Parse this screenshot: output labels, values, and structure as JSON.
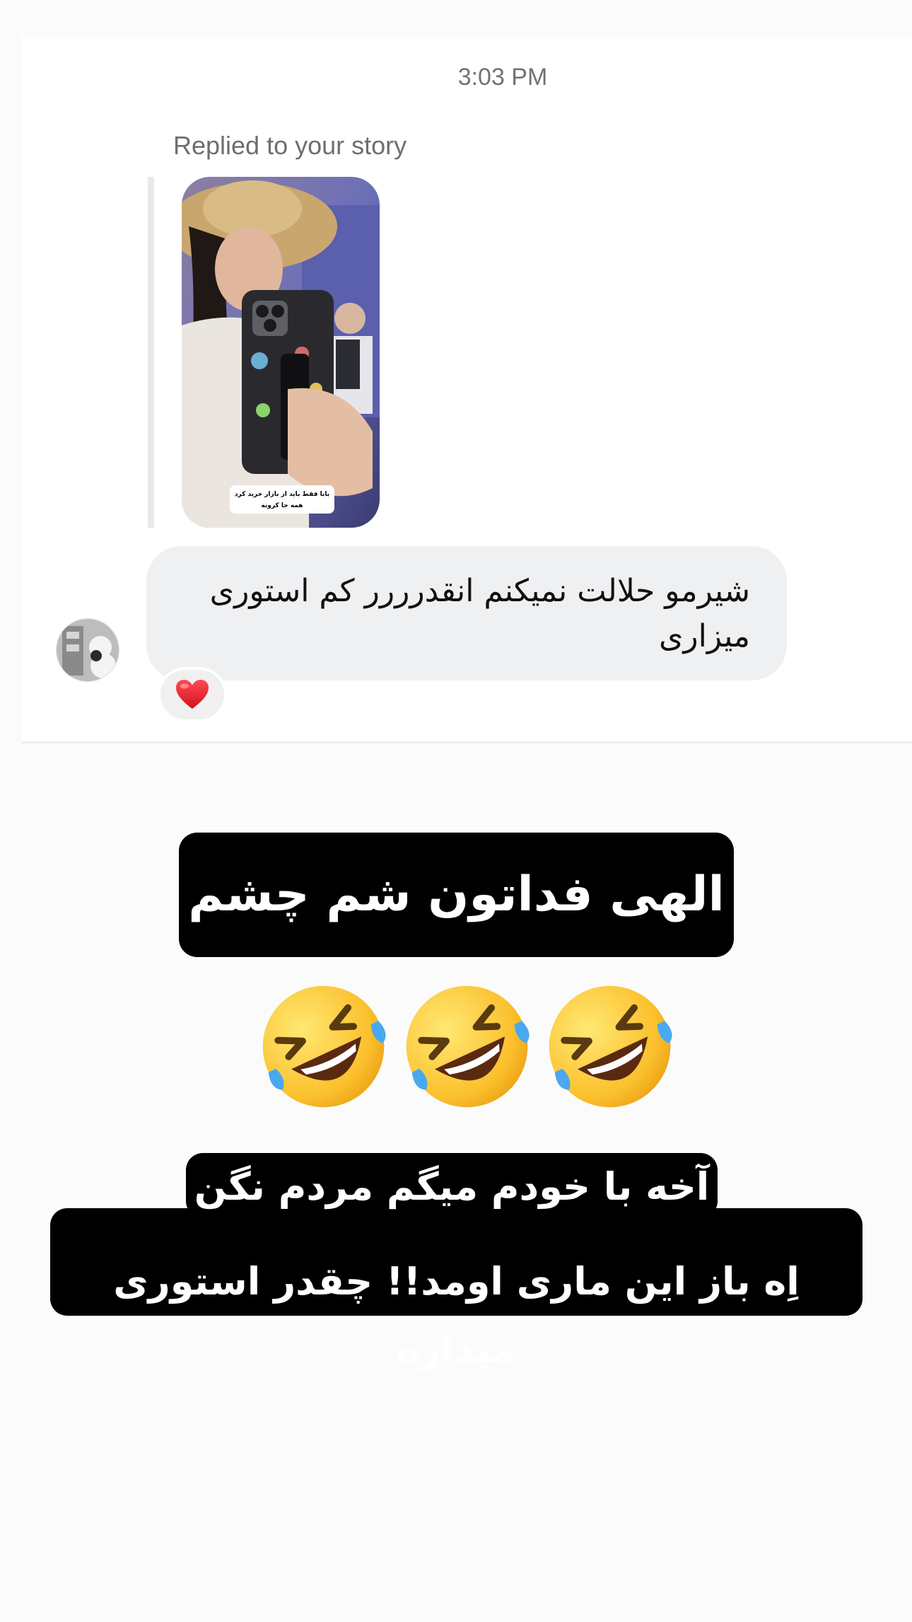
{
  "thread": {
    "timestamp": "3:03 PM",
    "reply_caption": "Replied to your story",
    "story": {
      "caption_line1": "بابا فقط باید از بازار خرید کرد",
      "caption_line2": "همه جا کرونه"
    },
    "message": {
      "text": "شیرمو حلالت نمیکنم انقدرررر کم استوری میزاری",
      "reaction_icon": "red-heart-icon"
    }
  },
  "overlay": {
    "text1": "الهی فداتون شم چشم",
    "emoji_icon": "rolling-on-floor-laughing-emoji",
    "emoji_count": 3,
    "text2_line1": "آخه با خودم میگم مردم نگن",
    "text2_line2": "اِه باز این ماری اومد!! چقدر استوری میذاره"
  },
  "colors": {
    "bubble": "#eff0f2",
    "overlay_bg": "#000000",
    "overlay_text": "#ffffff",
    "heart": "#e0202e"
  }
}
